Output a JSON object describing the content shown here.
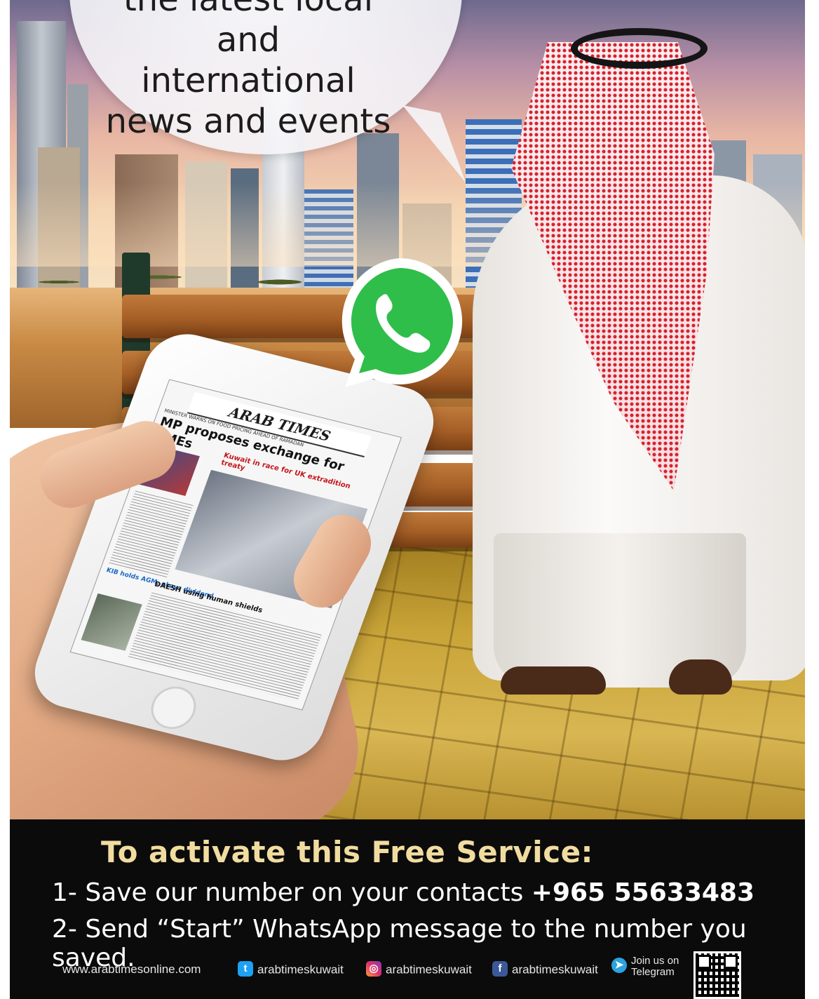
{
  "bubble": {
    "line1": "the latest local and",
    "line2": "international",
    "line3": "news and events"
  },
  "newspaper": {
    "masthead": "ARAB TIMES",
    "kicker": "MINISTER WARNS ON FOOD PRICING AHEAD OF RAMADAN",
    "headline": "MP proposes exchange for SMEs",
    "subheadline": "Kuwait in race for UK extradition treaty",
    "side_blue": "KIB holds AGM, okays dividend",
    "side_story": "DAESH using human shields"
  },
  "cta": {
    "title": "To activate this Free Service:",
    "step1_text": "1- Save our number on your contacts ",
    "step1_number": "+965 55633483",
    "step2_text": "2- Send “Start” WhatsApp message to the number you saved."
  },
  "footer": {
    "website": "www.arabtimesonline.com",
    "twitter": "arabtimeskuwait",
    "instagram": "arabtimeskuwait",
    "facebook": "arabtimeskuwait",
    "telegram_line1": "Join us on",
    "telegram_line2": "Telegram"
  },
  "colors": {
    "panel_bg": "#0b0b0b",
    "cta_title": "#f1dca0",
    "whatsapp_green": "#25d366"
  },
  "icons": [
    "whatsapp-icon",
    "twitter-icon",
    "instagram-icon",
    "facebook-icon",
    "telegram-icon",
    "qr-code-icon"
  ]
}
